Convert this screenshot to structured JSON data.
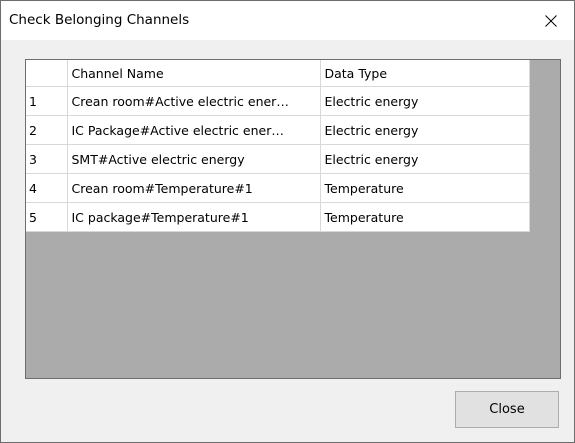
{
  "window": {
    "title": "Check Belonging Channels",
    "close_icon": "close-icon"
  },
  "table": {
    "columns": [
      "",
      "Channel Name",
      "Data Type"
    ],
    "rows": [
      {
        "index": "1",
        "channel_name": "Crean room#Active electric ener…",
        "data_type": "Electric energy"
      },
      {
        "index": "2",
        "channel_name": "IC Package#Active electric ener…",
        "data_type": "Electric energy"
      },
      {
        "index": "3",
        "channel_name": "SMT#Active electric energy",
        "data_type": "Electric energy"
      },
      {
        "index": "4",
        "channel_name": "Crean room#Temperature#1",
        "data_type": "Temperature"
      },
      {
        "index": "5",
        "channel_name": "IC package#Temperature#1",
        "data_type": "Temperature"
      }
    ]
  },
  "buttons": {
    "close_label": "Close"
  },
  "colors": {
    "grid_background": "#ababab",
    "dialog_background": "#f0f0f0",
    "button_face": "#e1e1e1"
  }
}
